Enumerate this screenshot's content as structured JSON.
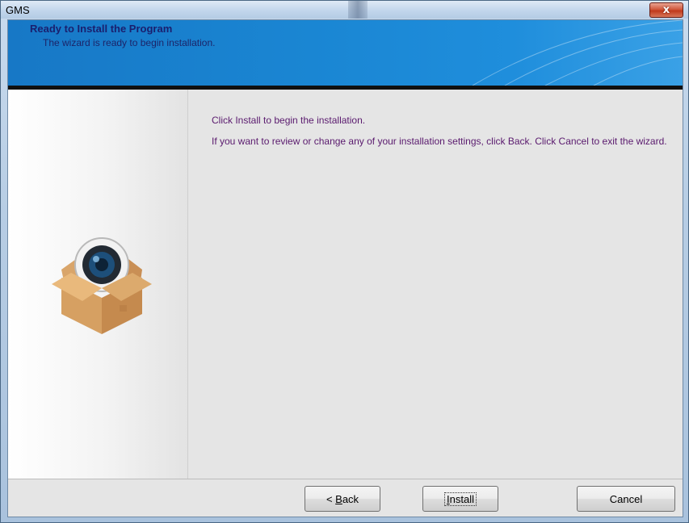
{
  "window": {
    "title": "GMS",
    "close_label": "x"
  },
  "banner": {
    "title": "Ready to Install the Program",
    "subtitle": "The wizard is ready to begin installation."
  },
  "content": {
    "line1": "Click Install to begin the installation.",
    "line2": "If you want to review or change any of your installation settings, click Back. Click Cancel to exit the wizard."
  },
  "buttons": {
    "back": {
      "prefix": "< ",
      "mnemonic": "B",
      "rest": "ack"
    },
    "install": {
      "mnemonic": "I",
      "rest": "nstall"
    },
    "cancel": "Cancel"
  },
  "colors": {
    "banner_blue": "#1a86d3",
    "title_text": "#1a1f6e",
    "body_text": "#5a1a6e",
    "close_red": "#c0391b"
  },
  "icons": {
    "product": "camera-in-box-icon",
    "close": "close-icon"
  }
}
